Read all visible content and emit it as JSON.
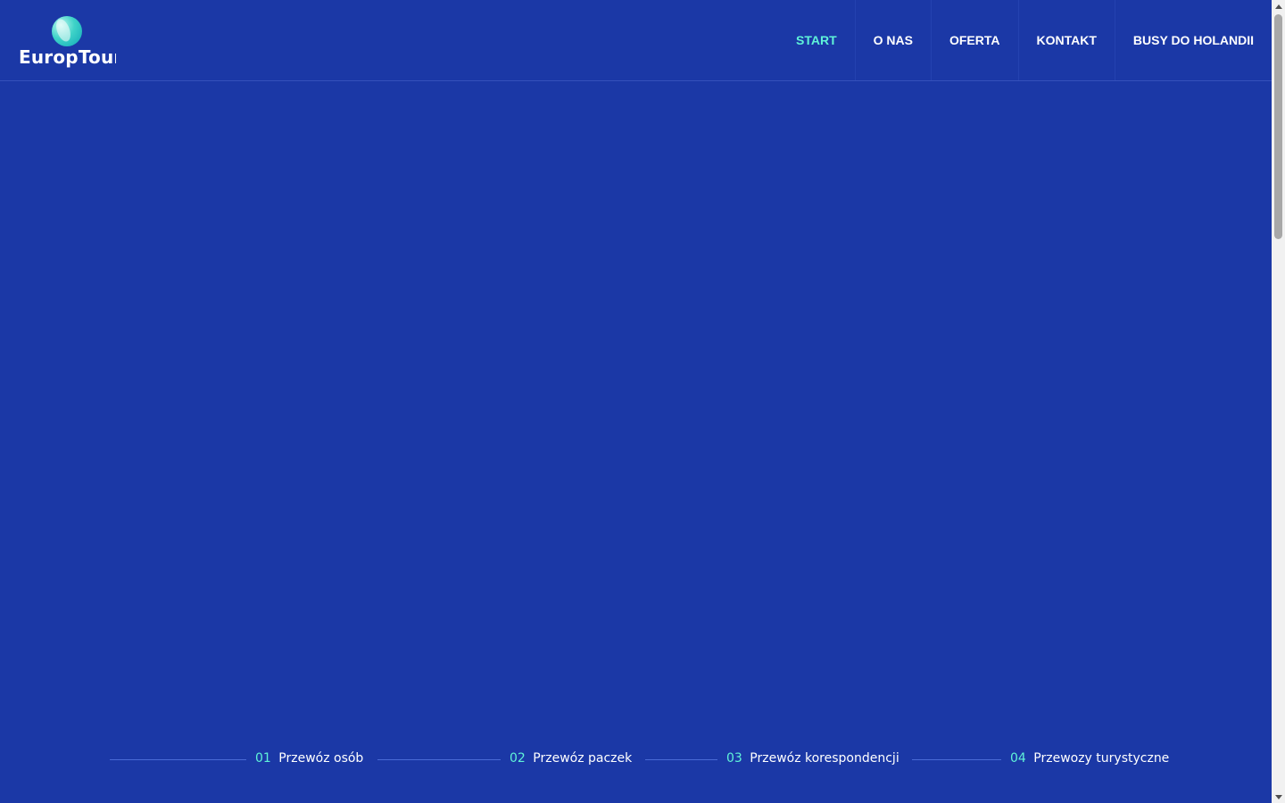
{
  "brand": {
    "name": "EuropTour"
  },
  "nav": {
    "items": [
      {
        "label": "START",
        "active": true
      },
      {
        "label": "O NAS"
      },
      {
        "label": "OFERTA"
      },
      {
        "label": "KONTAKT"
      },
      {
        "label": "BUSY DO HOLANDII"
      }
    ]
  },
  "services": [
    {
      "number": "01",
      "label": "Przewóz osób"
    },
    {
      "number": "02",
      "label": "Przewóz paczek"
    },
    {
      "number": "03",
      "label": "Przewóz korespondencji"
    },
    {
      "number": "04",
      "label": "Przewozy turystyczne"
    }
  ],
  "colors": {
    "background": "#1b38a6",
    "accent": "#5ff3d8",
    "text": "#ffffff"
  },
  "icons": {
    "logo": "sphere-logo-icon",
    "scroll_up": "scroll-up-arrow-icon",
    "scroll_down": "scroll-down-arrow-icon"
  }
}
